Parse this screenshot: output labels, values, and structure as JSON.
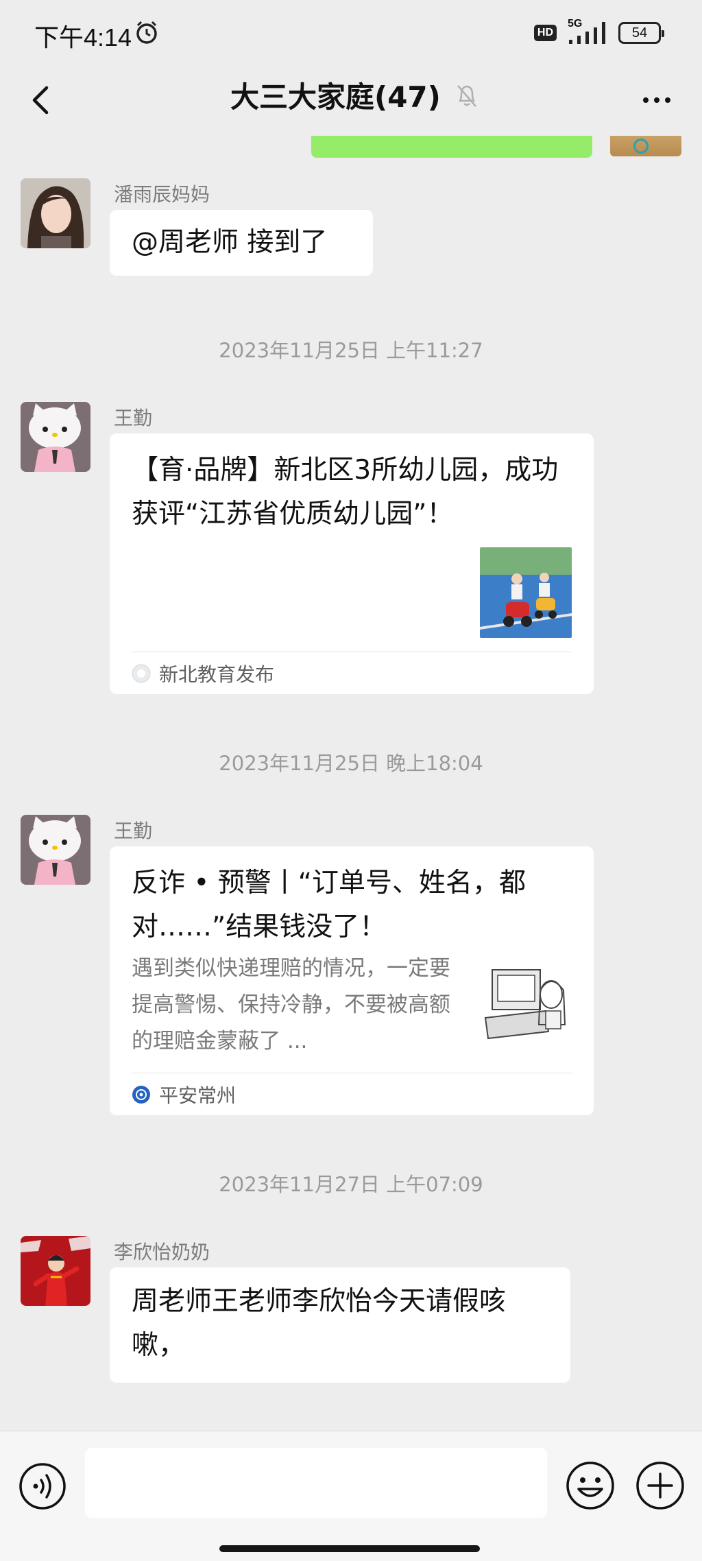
{
  "status_bar": {
    "time": "下午4:14",
    "hd_badge": "HD",
    "network": "5G",
    "battery": "54"
  },
  "nav": {
    "title": "大三大家庭(47)",
    "back_icon": "chevron-left-icon",
    "mute_icon": "bell-off-icon",
    "more_icon": "more-dots-icon"
  },
  "messages": [
    {
      "sender": "潘雨辰妈妈",
      "text": "@周老师  接到了"
    },
    {
      "timestamp": "2023年11月25日 上午11:27",
      "sender": "王勤",
      "card_title": "【育·品牌】新北区3所幼儿园，成功获评“江苏省优质幼儿园”！",
      "card_source": "新北教育发布"
    },
    {
      "timestamp": "2023年11月25日 晚上18:04",
      "sender": "王勤",
      "card_title": "反诈 • 预警丨“订单号、姓名，都对……”结果钱没了！",
      "card_desc": "遇到类似快递理赔的情况，一定要提高警惕、保持冷静，不要被高额的理赔金蒙蔽了 ...",
      "card_source": "平安常州"
    },
    {
      "timestamp": "2023年11月27日 上午07:09",
      "sender": "李欣怡奶奶",
      "text": "周老师王老师李欣怡今天请假咳嗽，"
    }
  ],
  "input_bar": {
    "voice_icon": "voice-icon",
    "emoji_icon": "emoji-icon",
    "plus_icon": "plus-icon"
  },
  "colors": {
    "background": "#ededed",
    "self_bubble": "#95ec69",
    "bubble": "#ffffff",
    "meta_text": "#9a9a9a"
  }
}
